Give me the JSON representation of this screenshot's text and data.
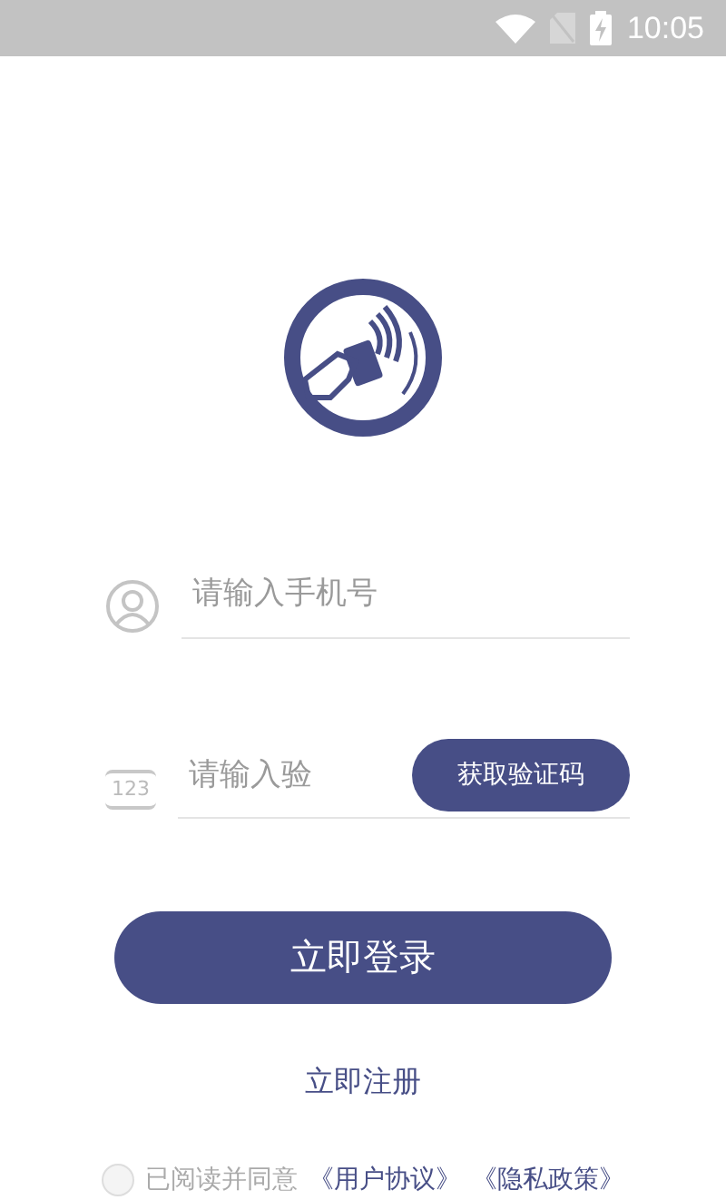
{
  "status_bar": {
    "time": "10:05"
  },
  "login_form": {
    "phone_field": {
      "placeholder": "请输入手机号"
    },
    "code_field": {
      "icon_text": "123",
      "placeholder": "请输入验"
    },
    "get_code_button": "获取验证码",
    "login_button": "立即登录",
    "register_link": "立即注册"
  },
  "agreement": {
    "checked": false,
    "text": "已阅读并同意",
    "links": [
      "《用户协议》",
      "《隐私政策》"
    ]
  }
}
